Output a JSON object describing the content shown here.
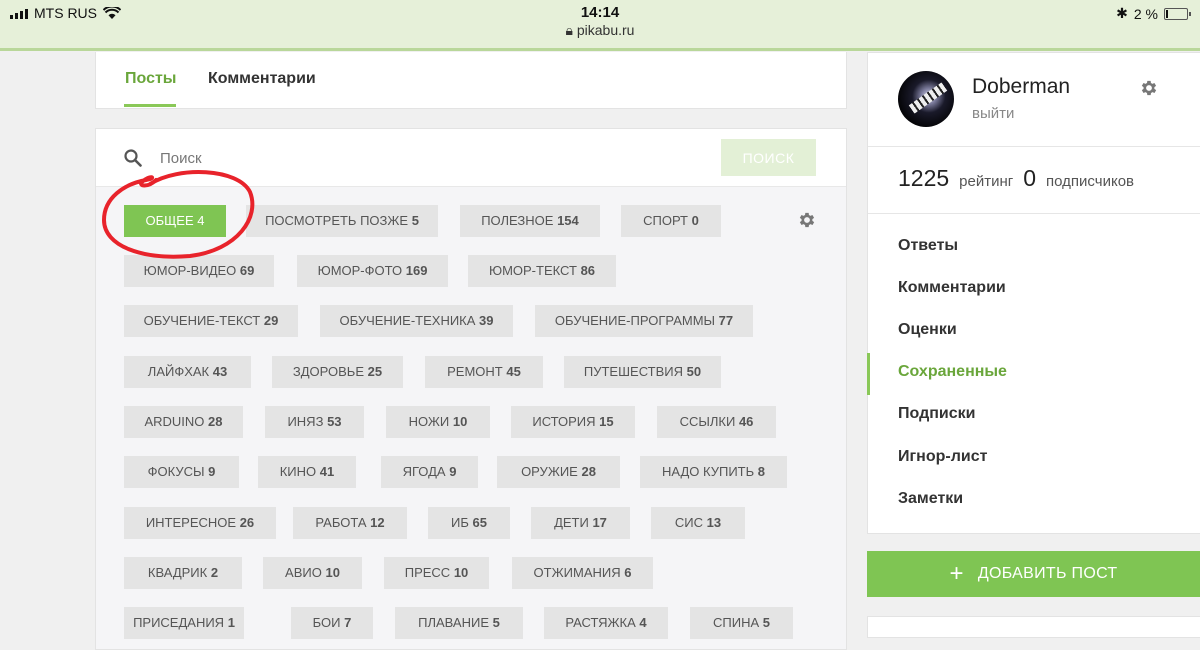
{
  "status_bar": {
    "carrier": "MTS RUS",
    "time": "14:14",
    "url": "pikabu.ru",
    "battery": "2 %"
  },
  "tabs": [
    {
      "label": "Посты",
      "active": true
    },
    {
      "label": "Комментарии",
      "active": false
    }
  ],
  "search": {
    "placeholder": "Поиск",
    "button_label": "ПОИСК"
  },
  "categories": [
    {
      "name": "ОБЩЕЕ",
      "count": "4",
      "active": true
    },
    {
      "name": "ПОСМОТРЕТЬ ПОЗЖЕ",
      "count": "5"
    },
    {
      "name": "ПОЛЕЗНОЕ",
      "count": "154"
    },
    {
      "name": "СПОРТ",
      "count": "0"
    },
    {
      "name": "ЮМОР-ВИДЕО",
      "count": "69"
    },
    {
      "name": "ЮМОР-ФОТО",
      "count": "169"
    },
    {
      "name": "ЮМОР-ТЕКСТ",
      "count": "86"
    },
    {
      "name": "ОБУЧЕНИЕ-ТЕКСТ",
      "count": "29"
    },
    {
      "name": "ОБУЧЕНИЕ-ТЕХНИКА",
      "count": "39"
    },
    {
      "name": "ОБУЧЕНИЕ-ПРОГРАММЫ",
      "count": "77"
    },
    {
      "name": "ЛАЙФХАК",
      "count": "43"
    },
    {
      "name": "ЗДОРОВЬЕ",
      "count": "25"
    },
    {
      "name": "РЕМОНТ",
      "count": "45"
    },
    {
      "name": "ПУТЕШЕСТВИЯ",
      "count": "50"
    },
    {
      "name": "ARDUINO",
      "count": "28"
    },
    {
      "name": "ИНЯЗ",
      "count": "53"
    },
    {
      "name": "НОЖИ",
      "count": "10"
    },
    {
      "name": "ИСТОРИЯ",
      "count": "15"
    },
    {
      "name": "ССЫЛКИ",
      "count": "46"
    },
    {
      "name": "ФОКУСЫ",
      "count": "9"
    },
    {
      "name": "КИНО",
      "count": "41"
    },
    {
      "name": "ЯГОДА",
      "count": "9"
    },
    {
      "name": "ОРУЖИЕ",
      "count": "28"
    },
    {
      "name": "НАДО КУПИТЬ",
      "count": "8"
    },
    {
      "name": "ИНТЕРЕСНОЕ",
      "count": "26"
    },
    {
      "name": "РАБОТА",
      "count": "12"
    },
    {
      "name": "ИБ",
      "count": "65"
    },
    {
      "name": "ДЕТИ",
      "count": "17"
    },
    {
      "name": "СИС",
      "count": "13"
    },
    {
      "name": "КВАДРИК",
      "count": "2"
    },
    {
      "name": "АВИО",
      "count": "10"
    },
    {
      "name": "ПРЕСС",
      "count": "10"
    },
    {
      "name": "ОТЖИМАНИЯ",
      "count": "6"
    },
    {
      "name": "ПРИСЕДАНИЯ",
      "count": "1"
    },
    {
      "name": "БОИ",
      "count": "7"
    },
    {
      "name": "ПЛАВАНИЕ",
      "count": "5"
    },
    {
      "name": "РАСТЯЖКА",
      "count": "4"
    },
    {
      "name": "СПИНА",
      "count": "5"
    }
  ],
  "profile": {
    "username": "Doberman",
    "logout": "выйти",
    "rating_value": "1225",
    "rating_label": "рейтинг",
    "subscribers_value": "0",
    "subscribers_label": "подписчиков"
  },
  "menu": [
    {
      "label": "Ответы"
    },
    {
      "label": "Комментарии"
    },
    {
      "label": "Оценки"
    },
    {
      "label": "Сохраненные",
      "active": true
    },
    {
      "label": "Подписки"
    },
    {
      "label": "Игнор-лист"
    },
    {
      "label": "Заметки"
    }
  ],
  "add_post": {
    "label": "ДОБАВИТЬ ПОСТ"
  },
  "colors": {
    "accent": "#7fc553",
    "active_text": "#6aa63b",
    "annotation": "#e8232b"
  }
}
